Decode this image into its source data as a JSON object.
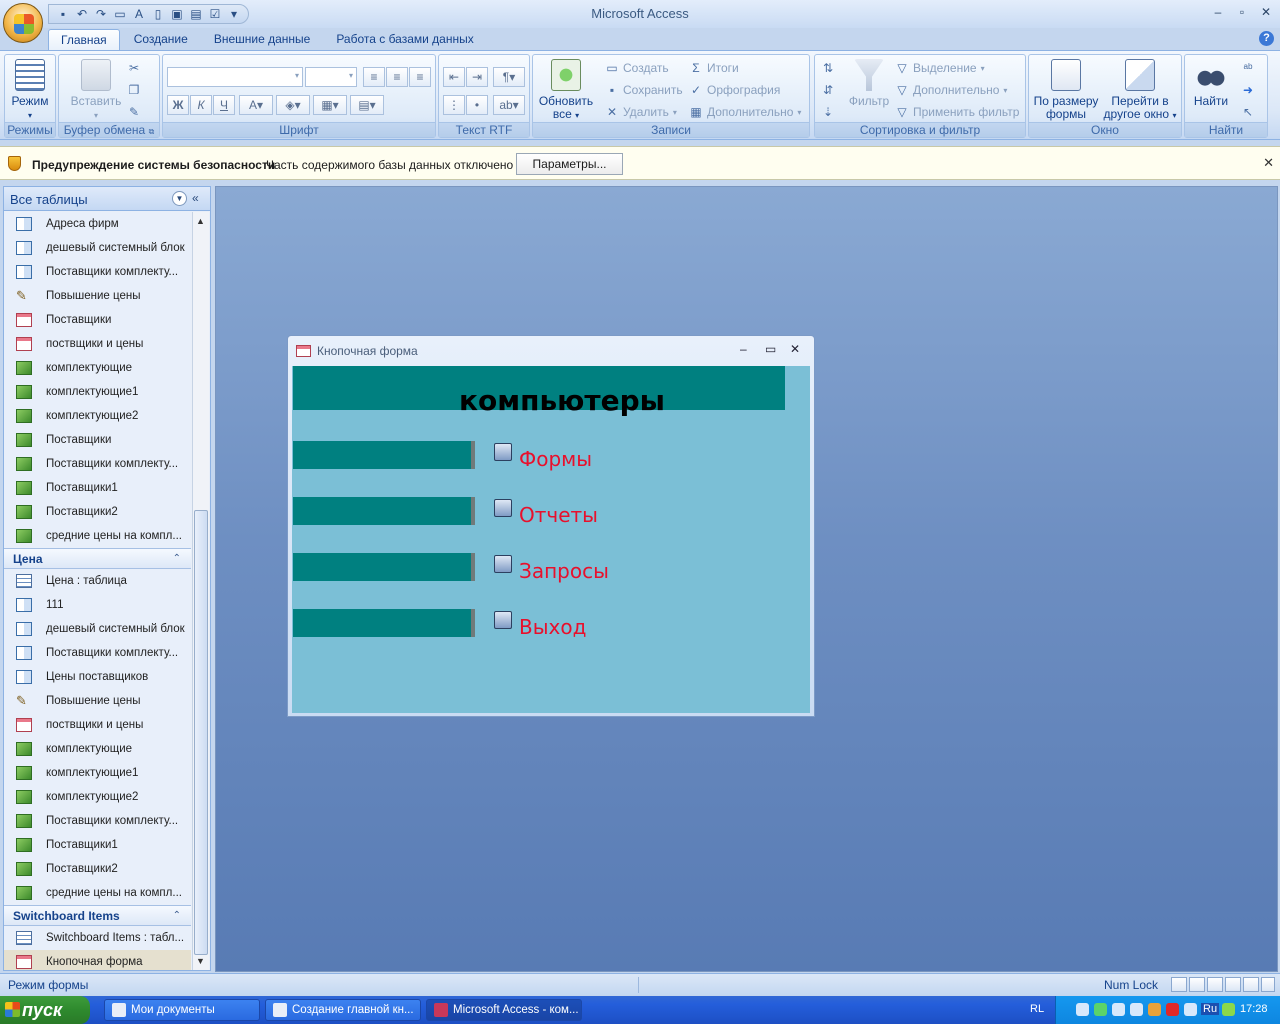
{
  "window": {
    "title": "Microsoft Access"
  },
  "ribbon": {
    "tabs": [
      "Главная",
      "Создание",
      "Внешние данные",
      "Работа с базами данных"
    ],
    "groups": {
      "modes": {
        "label": "Режимы",
        "mode_button": "Режим"
      },
      "clipboard": {
        "label": "Буфер обмена",
        "paste_button": "Вставить"
      },
      "font": {
        "label": "Шрифт"
      },
      "rtf": {
        "label": "Текст RTF"
      },
      "records": {
        "label": "Записи",
        "refresh_button": "Обновить все",
        "new": "Создать",
        "save": "Сохранить",
        "delete": "Удалить",
        "totals": "Итоги",
        "spelling": "Орфография",
        "more": "Дополнительно"
      },
      "sort_filter": {
        "label": "Сортировка и фильтр",
        "filter_button": "Фильтр",
        "selection": "Выделение",
        "advanced": "Дополнительно",
        "toggle_filter": "Применить фильтр"
      },
      "window": {
        "label": "Окно",
        "size_to_fit": "По размеру формы",
        "switch_windows": "Перейти в другое окно"
      },
      "find": {
        "label": "Найти",
        "find_button": "Найти"
      }
    }
  },
  "security_bar": {
    "title": "Предупреждение системы безопасности",
    "message": "Часть содержимого базы данных отключено",
    "options_button": "Параметры..."
  },
  "nav_pane": {
    "header": "Все таблицы",
    "top_items": [
      {
        "label": "Адреса фирм",
        "icon": "query"
      },
      {
        "label": "дешевый системный блок",
        "icon": "query"
      },
      {
        "label": "Поставщики комплекту...",
        "icon": "query"
      },
      {
        "label": "Повышение цены",
        "icon": "update"
      },
      {
        "label": "Поставщики",
        "icon": "form"
      },
      {
        "label": "поствщики и цены",
        "icon": "form"
      },
      {
        "label": "комплектующие",
        "icon": "report"
      },
      {
        "label": "комплектующие1",
        "icon": "report"
      },
      {
        "label": "комплектующие2",
        "icon": "report"
      },
      {
        "label": "Поставщики",
        "icon": "report"
      },
      {
        "label": "Поставщики комплекту...",
        "icon": "report"
      },
      {
        "label": "Поставщики1",
        "icon": "report"
      },
      {
        "label": "Поставщики2",
        "icon": "report"
      },
      {
        "label": "средние цены на компл...",
        "icon": "report"
      }
    ],
    "group_price": {
      "title": "Цена",
      "items": [
        {
          "label": "Цена : таблица",
          "icon": "table"
        },
        {
          "label": "111",
          "icon": "query"
        },
        {
          "label": "дешевый системный блок",
          "icon": "query"
        },
        {
          "label": "Поставщики комплекту...",
          "icon": "query"
        },
        {
          "label": "Цены поставщиков",
          "icon": "query"
        },
        {
          "label": "Повышение цены",
          "icon": "update"
        },
        {
          "label": "поствщики и цены",
          "icon": "form"
        },
        {
          "label": "комплектующие",
          "icon": "report"
        },
        {
          "label": "комплектующие1",
          "icon": "report"
        },
        {
          "label": "комплектующие2",
          "icon": "report"
        },
        {
          "label": "Поставщики комплекту...",
          "icon": "report"
        },
        {
          "label": "Поставщики1",
          "icon": "report"
        },
        {
          "label": "Поставщики2",
          "icon": "report"
        },
        {
          "label": "средние цены на компл...",
          "icon": "report"
        }
      ]
    },
    "group_switchboard": {
      "title": "Switchboard Items",
      "items": [
        {
          "label": "Switchboard Items : табл...",
          "icon": "table"
        },
        {
          "label": "Кнопочная форма",
          "icon": "form",
          "selected": true
        }
      ]
    }
  },
  "form_window": {
    "title": "Кнопочная форма",
    "heading": "компьютеры",
    "buttons": [
      "Формы",
      "Отчеты",
      "Запросы",
      "Выход"
    ],
    "colors": {
      "band": "#008080",
      "body": "#7bbfd6",
      "label": "#e8102c"
    }
  },
  "status_bar": {
    "mode": "Режим формы",
    "numlock": "Num Lock"
  },
  "taskbar": {
    "start": "пуск",
    "tasks": [
      "Мои документы",
      "Создание главной кн...",
      "Microsoft Access - ком..."
    ],
    "lang_left": "RL",
    "lang_right": "Ru",
    "clock": "17:28"
  }
}
